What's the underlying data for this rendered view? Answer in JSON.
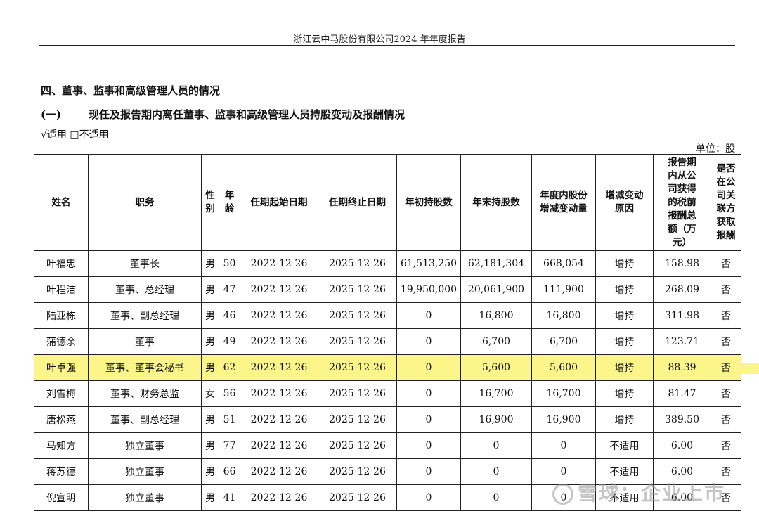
{
  "header": {
    "title": "浙江云中马股份有限公司2024 年年度报告"
  },
  "section": {
    "title": "四、董事、监事和高级管理人员的情况",
    "sub_num": "(一)",
    "sub_title": "现任及报告期内离任董事、监事和高级管理人员持股变动及报酬情况",
    "applicable": "√适用 □不适用",
    "unit": "单位：股"
  },
  "table": {
    "headers": [
      "姓名",
      "职务",
      "性别",
      "年龄",
      "任期起始日期",
      "任期终止日期",
      "年初持股数",
      "年末持股数",
      "年度内股份增减变动量",
      "增减变动原因",
      "报告期内从公司获得的税前报酬总额（万元）",
      "是否在公司关联方获取报酬"
    ],
    "header_display": [
      "姓名",
      "职务",
      "性\n别",
      "年\n龄",
      "任期起始日期",
      "任期终止日期",
      "年初持股数",
      "年末持股数",
      "年度内股份\n增减变动量",
      "增减变动\n原因",
      "报告期\n内从公\n司获得\n的税前\n报酬总\n额（万\n元）",
      "是否\n在公\n司关\n联方\n获取\n报酬"
    ],
    "rows": [
      [
        "叶福忠",
        "董事长",
        "男",
        "50",
        "2022-12-26",
        "2025-12-26",
        "61,513,250",
        "62,181,304",
        "668,054",
        "增持",
        "158.98",
        "否"
      ],
      [
        "叶程洁",
        "董事、总经理",
        "男",
        "47",
        "2022-12-26",
        "2025-12-26",
        "19,950,000",
        "20,061,900",
        "111,900",
        "增持",
        "268.09",
        "否"
      ],
      [
        "陆亚栋",
        "董事、副总经理",
        "男",
        "46",
        "2022-12-26",
        "2025-12-26",
        "0",
        "16,800",
        "16,800",
        "增持",
        "311.98",
        "否"
      ],
      [
        "蒲德余",
        "董事",
        "男",
        "49",
        "2022-12-26",
        "2025-12-26",
        "0",
        "6,700",
        "6,700",
        "增持",
        "123.71",
        "否"
      ],
      [
        "叶卓强",
        "董事、董事会秘书",
        "男",
        "62",
        "2022-12-26",
        "2025-12-26",
        "0",
        "5,600",
        "5,600",
        "增持",
        "88.39",
        "否"
      ],
      [
        "刘雪梅",
        "董事、财务总监",
        "女",
        "56",
        "2022-12-26",
        "2025-12-26",
        "0",
        "16,700",
        "16,700",
        "增持",
        "81.47",
        "否"
      ],
      [
        "唐松燕",
        "董事、副总经理",
        "男",
        "51",
        "2022-12-26",
        "2025-12-26",
        "0",
        "16,900",
        "16,900",
        "增持",
        "389.50",
        "否"
      ],
      [
        "马知方",
        "独立董事",
        "男",
        "77",
        "2022-12-26",
        "2025-12-26",
        "0",
        "0",
        "0",
        "不适用",
        "6.00",
        "否"
      ],
      [
        "蒋苏德",
        "独立董事",
        "男",
        "66",
        "2022-12-26",
        "2025-12-26",
        "0",
        "0",
        "0",
        "不适用",
        "6.00",
        "否"
      ],
      [
        "倪宣明",
        "独立董事",
        "男",
        "41",
        "2022-12-26",
        "2025-12-26",
        "0",
        "0",
        "0",
        "不适用",
        "6.00",
        "否"
      ]
    ],
    "highlight_row": 4,
    "highlight_color": "#fbf58a"
  },
  "watermark": {
    "text": "雪球：企业上市"
  }
}
